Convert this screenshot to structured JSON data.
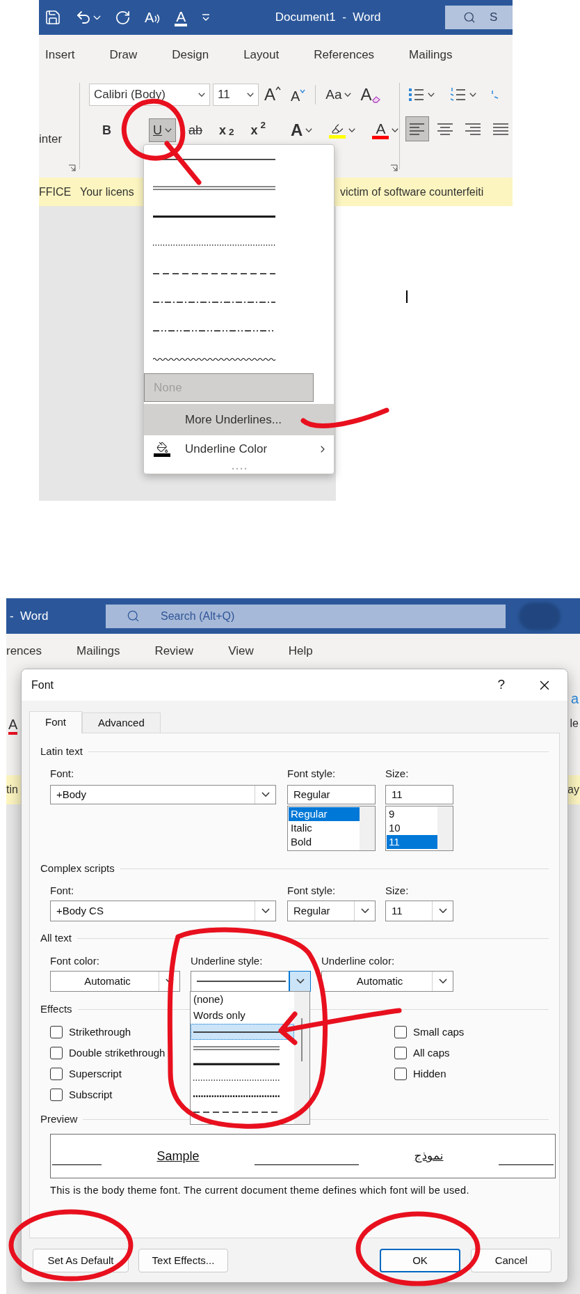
{
  "top_window": {
    "quick_access": [
      {
        "kind": "save"
      },
      {
        "kind": "undo"
      },
      {
        "kind": "redo"
      },
      {
        "kind": "read_aloud",
        "label": "A"
      },
      {
        "kind": "font_color",
        "label": "A"
      },
      {
        "kind": "customize"
      }
    ],
    "title": "Document1  -  Word",
    "search_text": "S",
    "tabs": [
      "Insert",
      "Draw",
      "Design",
      "Layout",
      "References",
      "Mailings"
    ],
    "clipboard_fragment": "inter",
    "font_name": "Calibri (Body)",
    "font_size": "11",
    "font_tools": [
      {
        "kind": "grow",
        "label": "A"
      },
      {
        "kind": "shrink",
        "label": "A"
      },
      {
        "kind": "case",
        "label": "Aa"
      },
      {
        "kind": "clear",
        "label": "A"
      }
    ],
    "format_buttons": [
      {
        "kind": "bold",
        "label": "B",
        "selected": false
      },
      {
        "kind": "underline",
        "label": "U",
        "selected": true
      },
      {
        "kind": "strike",
        "label": "ab",
        "selected": false
      },
      {
        "kind": "subscript",
        "label": "x$_{2}$",
        "selected": false
      },
      {
        "kind": "superscript",
        "label": "x$^{2}$",
        "selected": false
      },
      {
        "kind": "text_effects",
        "label": "A",
        "selected": false
      },
      {
        "kind": "highlight",
        "color": "#ffff00",
        "selected": false
      },
      {
        "kind": "font_color",
        "label": "A",
        "color": "#ff0000",
        "selected": false
      }
    ],
    "paragraph_lists": [
      {
        "kind": "bullets"
      },
      {
        "kind": "numbering"
      },
      {
        "kind": "multilevel"
      }
    ],
    "align_buttons": [
      {
        "kind": "left",
        "selected": true
      },
      {
        "kind": "center",
        "selected": false
      },
      {
        "kind": "right",
        "selected": false
      },
      {
        "kind": "justify",
        "selected": false
      }
    ],
    "banner": {
      "label": "FFICE",
      "message_start": "Your licens",
      "message_end": "victim of software counterfeiti"
    }
  },
  "underline_menu": {
    "styles": [
      {
        "kind": "single"
      },
      {
        "kind": "double"
      },
      {
        "kind": "thick"
      },
      {
        "kind": "dotted"
      },
      {
        "kind": "dashed"
      },
      {
        "kind": "dot-dash"
      },
      {
        "kind": "dot-dot-dash"
      },
      {
        "kind": "wavy"
      }
    ],
    "none": {
      "label": "None",
      "focused": true
    },
    "more": {
      "label": "More Underlines...",
      "highlighted": true
    },
    "color_item": {
      "label": "Underline Color"
    }
  },
  "bottom_window": {
    "title": "-  Word",
    "search_placeholder": "Search (Alt+Q)",
    "tabs": [
      "rences",
      "Mailings",
      "Review",
      "View",
      "Help"
    ],
    "left_fragments": [
      "A",
      "tin"
    ],
    "right_fragments": [
      "a",
      "le",
      "ay"
    ]
  },
  "font_dialog": {
    "title": "Font",
    "help": "?",
    "tabs": [
      {
        "label": "Font",
        "selected": true
      },
      {
        "label": "Advanced",
        "selected": false
      }
    ],
    "latin": {
      "heading": "Latin text",
      "font_label": "Font:",
      "font": "+Body",
      "style_label": "Font style:",
      "style": "Regular",
      "style_list": [
        {
          "label": "Regular",
          "selected": true
        },
        {
          "label": "Italic",
          "selected": false
        },
        {
          "label": "Bold",
          "selected": false
        }
      ],
      "size_label": "Size:",
      "size": "11",
      "size_list": [
        {
          "label": "9",
          "selected": false
        },
        {
          "label": "10",
          "selected": false
        },
        {
          "label": "11",
          "selected": true
        }
      ]
    },
    "complex": {
      "heading": "Complex scripts",
      "font_label": "Font:",
      "font": "+Body CS",
      "style_label": "Font style:",
      "style": "Regular",
      "size_label": "Size:",
      "size": "11"
    },
    "all_text": {
      "heading": "All text",
      "font_color_label": "Font color:",
      "font_color": "Automatic",
      "underline_style_label": "Underline style:",
      "underline_style": {
        "kind": "single"
      },
      "underline_color_label": "Underline color:",
      "underline_color": "Automatic",
      "underline_options": [
        {
          "kind": "text",
          "label": "(none)",
          "selected": false
        },
        {
          "kind": "text",
          "label": "Words only",
          "selected": false
        },
        {
          "kind": "single",
          "selected": true
        },
        {
          "kind": "double",
          "selected": false
        },
        {
          "kind": "thick",
          "selected": false
        },
        {
          "kind": "dotted",
          "selected": false
        },
        {
          "kind": "heavy-dotted",
          "selected": false
        },
        {
          "kind": "dashed",
          "selected": false
        }
      ]
    },
    "effects": {
      "heading": "Effects",
      "left": [
        {
          "label": "Strikethrough",
          "checked": false
        },
        {
          "label": "Double strikethrough",
          "checked": false
        },
        {
          "label": "Superscript",
          "checked": false
        },
        {
          "label": "Subscript",
          "checked": false
        }
      ],
      "right": [
        {
          "label": "Small caps",
          "checked": false
        },
        {
          "label": "All caps",
          "checked": false
        },
        {
          "label": "Hidden",
          "checked": false
        }
      ]
    },
    "preview": {
      "heading": "Preview",
      "sample": "Sample",
      "sample_complex": "نموذج",
      "note": "This is the body theme font. The current document theme defines which font will be used."
    },
    "left_buttons": [
      {
        "label": "Set As Default",
        "default": false
      },
      {
        "label": "Text Effects...",
        "default": false
      }
    ],
    "right_buttons": [
      {
        "label": "OK",
        "default": true
      },
      {
        "label": "Cancel",
        "default": false
      }
    ]
  }
}
